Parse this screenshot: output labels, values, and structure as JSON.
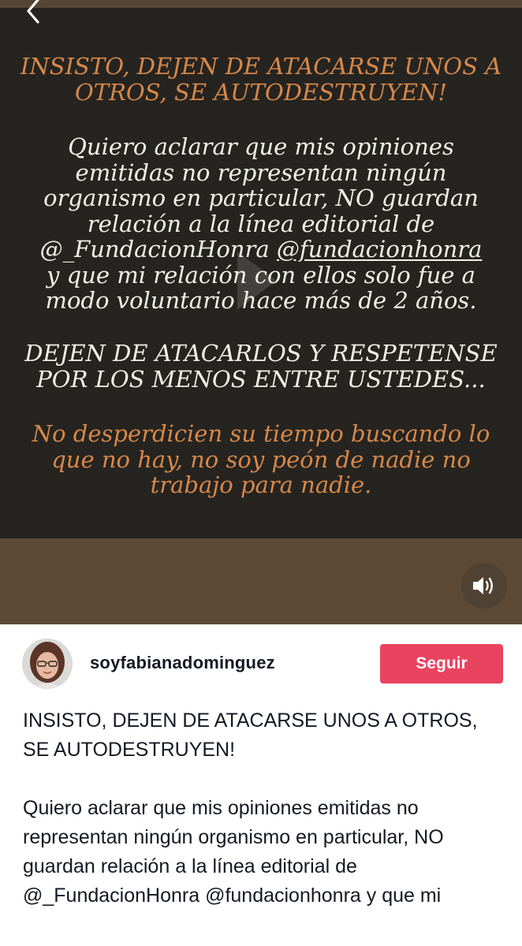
{
  "video": {
    "overlay": {
      "heading": [
        "INSISTO, DEJEN DE ATACARSE UNOS A",
        "OTROS, SE AUTODESTRUYEN!"
      ],
      "disclaimer_lines": [
        "Quiero aclarar que mis opiniones",
        "emitidas no representan ningún",
        "organismo en particular, NO guardan",
        "relación a la línea editorial de"
      ],
      "disclaimer_mention_prefix": "@_FundacionHonra ",
      "disclaimer_mention_link": "@fundacionhonra",
      "disclaimer_lines_end": [
        "y que mi relación con ellos solo fue a",
        "modo voluntario hace más de 2 años."
      ],
      "respect": [
        "DEJEN DE ATACARLOS Y RESPETENSE",
        "POR LOS MENOS ENTRE USTEDES..."
      ],
      "closing": [
        "No desperdicien su tiempo buscando lo",
        "que no hay, no soy peón de nadie no",
        "trabajo para nadie."
      ]
    },
    "icons": {
      "back": "chevron-left-icon",
      "play": "play-icon",
      "volume": "volume-icon"
    },
    "colors": {
      "panel": "#262420",
      "frame": "#5c4a36",
      "orange_text": "#d6884a",
      "white_text": "#f3efea"
    }
  },
  "post": {
    "username": "soyfabianadominguez",
    "follow_label": "Seguir",
    "follow_color": "#ea4360",
    "caption_para1": "INSISTO, DEJEN DE ATACARSE UNOS A OTROS, SE AUTODESTRUYEN!",
    "caption_para2": "Quiero aclarar que mis opiniones emitidas no representan ningún organismo en particular, NO guardan relación a la línea editorial de @_FundacionHonra @fundacionhonra y que mi"
  }
}
